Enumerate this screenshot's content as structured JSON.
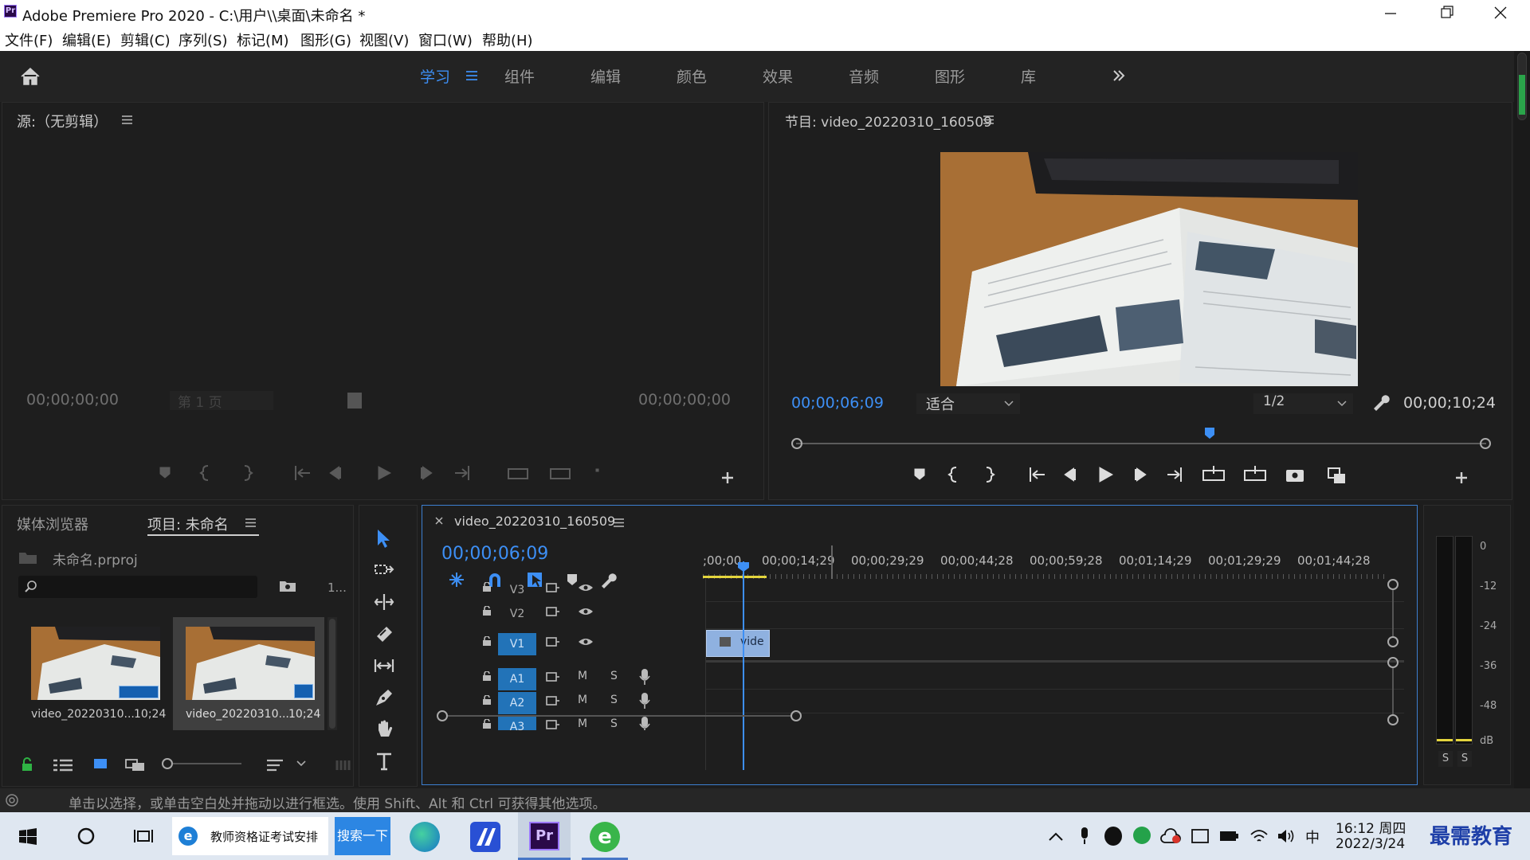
{
  "window": {
    "title": "Adobe Premiere Pro 2020 - C:\\用户\\\\桌面\\未命名 *",
    "app_icon": "Pr"
  },
  "menu": [
    "文件(F)",
    "编辑(E)",
    "剪辑(C)",
    "序列(S)",
    "标记(M)",
    "图形(G)",
    "视图(V)",
    "窗口(W)",
    "帮助(H)"
  ],
  "workspaces": {
    "tabs": [
      "学习",
      "组件",
      "编辑",
      "颜色",
      "效果",
      "音频",
      "图形",
      "库"
    ],
    "active": "学习",
    "more_icon": "double-chevron-right"
  },
  "source": {
    "title": "源:（无剪辑）",
    "timecode_in": "00;00;00;00",
    "timecode_out": "00;00;00;00",
    "page_select": "第 1 页"
  },
  "program": {
    "title": "节目: video_20220310_160509",
    "timecode": "00;00;06;09",
    "fit": "适合",
    "resolution": "1/2",
    "duration": "00;00;10;24",
    "playhead_fraction": 0.58
  },
  "project": {
    "tab_media": "媒体浏览器",
    "tab_project": "项目: 未命名",
    "file": "未命名.prproj",
    "count": "1...",
    "items": [
      {
        "name": "video_20220310...",
        "duration": "10;24"
      },
      {
        "name": "video_20220310...",
        "duration": "10;24"
      }
    ]
  },
  "timeline": {
    "tab": "video_20220310_160509",
    "timecode": "00;00;06;09",
    "ruler": [
      ";00;00",
      "00;00;14;29",
      "00;00;29;29",
      "00;00;44;28",
      "00;00;59;28",
      "00;01;14;29",
      "00;01;29;29",
      "00;01;44;28"
    ],
    "video_tracks": [
      "V3",
      "V2",
      "V1"
    ],
    "audio_tracks": [
      "A1",
      "A2",
      "A3"
    ],
    "clip_label": "vide",
    "mute": "M",
    "solo": "S"
  },
  "meter": {
    "scale": [
      "0",
      "-12",
      "-24",
      "-36",
      "-48",
      "dB"
    ],
    "solo_buttons": [
      "S",
      "S"
    ]
  },
  "status": "单击以选择，或单击空白处并拖动以进行框选。使用 Shift、Alt 和 Ctrl 可获得其他选项。",
  "taskbar": {
    "edge_tab": "教师资格证考试安排",
    "search_button": "搜索一下",
    "ime": "中",
    "time": "16:12 周四",
    "date": "2022/3/24",
    "watermark": "最需教育"
  }
}
